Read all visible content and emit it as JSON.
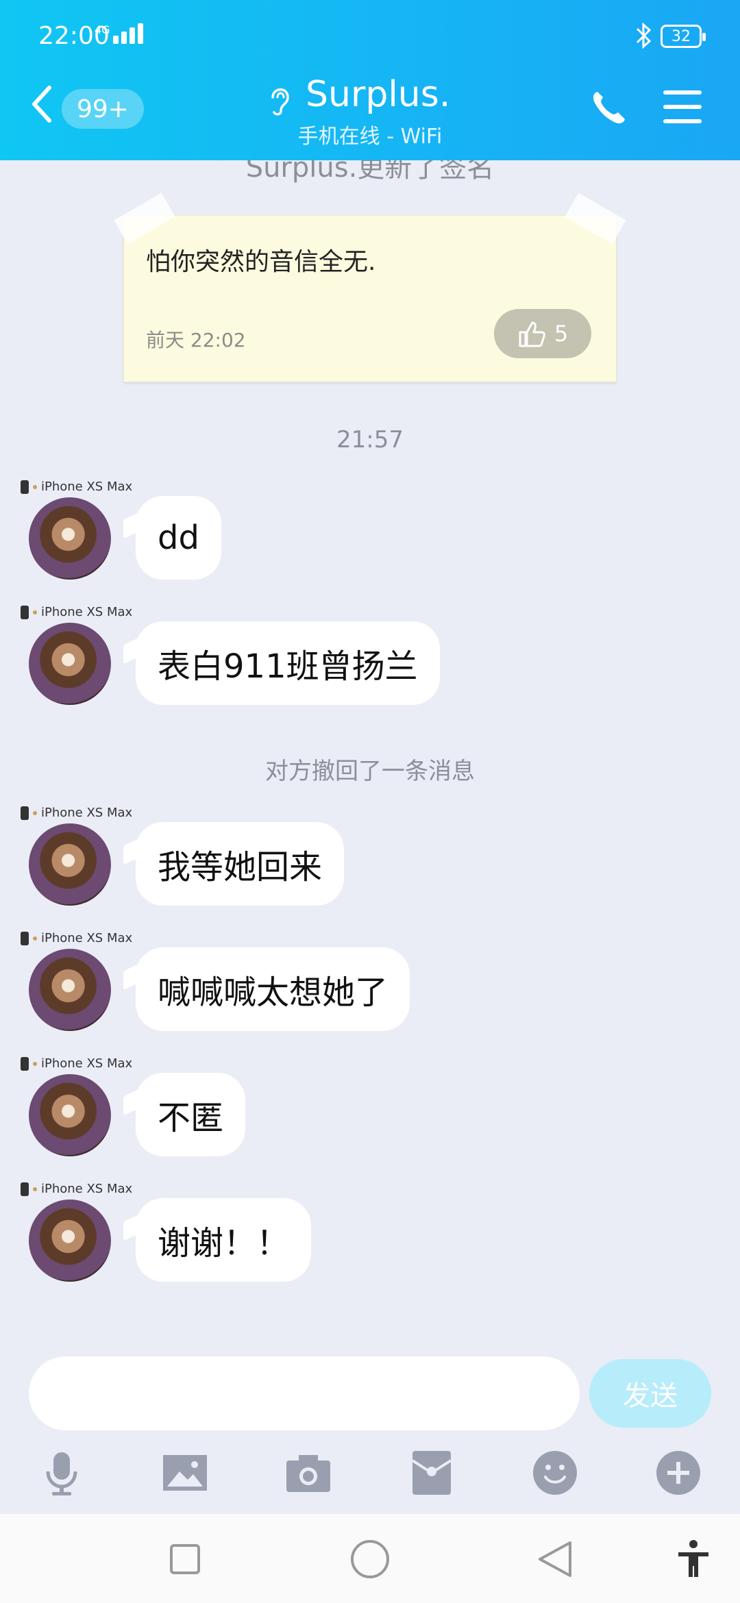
{
  "status": {
    "time": "22:00",
    "network": "4G",
    "battery": "32"
  },
  "header": {
    "unread_badge": "99+",
    "title": "Surplus.",
    "subtitle": "手机在线 - WiFi"
  },
  "notice_cut": "Surplus.更新了签名",
  "note": {
    "text": "怕你突然的音信全无.",
    "time": "前天 22:02",
    "likes": "5"
  },
  "time_separator": "21:57",
  "recall_notice": "对方撤回了一条消息",
  "messages": [
    {
      "device": "iPhone XS Max",
      "text": "dd"
    },
    {
      "device": "iPhone XS Max",
      "text": "表白911班曾扬兰"
    },
    {
      "device": "iPhone XS Max",
      "text": "我等她回来"
    },
    {
      "device": "iPhone XS Max",
      "text": "喊喊喊太想她了"
    },
    {
      "device": "iPhone XS Max",
      "text": "不匿"
    },
    {
      "device": "iPhone XS Max",
      "text": "谢谢！！"
    }
  ],
  "input": {
    "value": "",
    "send_label": "发送"
  },
  "toolbar_icons": [
    "microphone-icon",
    "image-icon",
    "camera-icon",
    "red-packet-icon",
    "emoji-icon",
    "plus-icon"
  ],
  "colors": {
    "header_start": "#10c6f3",
    "header_end": "#1aa7f4",
    "background": "#eaedf5",
    "send_disabled": "#b7ecfb"
  }
}
